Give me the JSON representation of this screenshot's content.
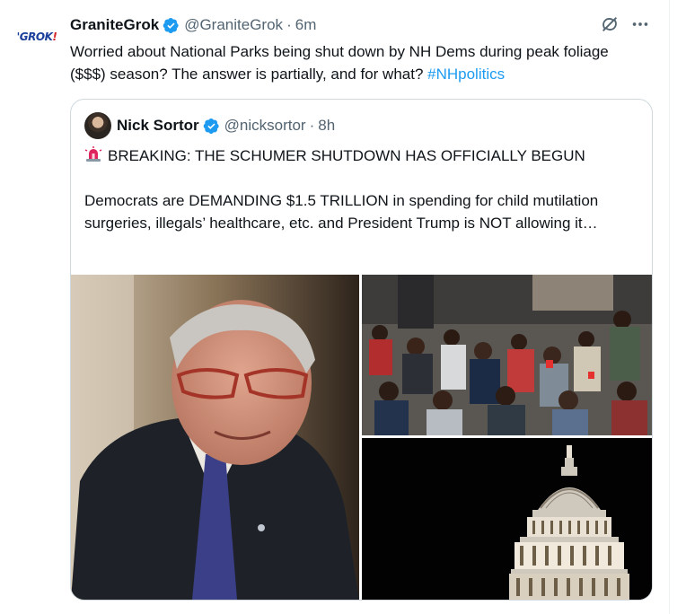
{
  "tweet": {
    "display_name": "GraniteGrok",
    "handle": "@GraniteGrok",
    "separator": "·",
    "time": "6m",
    "avatar_logo": {
      "a": "'GROK",
      "b": "!"
    },
    "text_before": "Worried about National Parks being shut down by NH Dems during peak foliage ($$$) season? The answer is partially, and for what? ",
    "hashtag": "#NHpolitics",
    "verified_icon": "verified-badge-icon",
    "grok_icon": "grok-icon",
    "more_icon": "more-options-icon"
  },
  "quote": {
    "display_name": "Nick Sortor",
    "handle": "@nicksortor",
    "separator": "·",
    "time": "8h",
    "alarm_icon": "rotating-light-icon",
    "line1": "BREAKING: THE SCHUMER SHUTDOWN HAS OFFICIALLY BEGUN",
    "line2": "Democrats are DEMANDING $1.5 TRILLION in spending for child mutilation surgeries, illegals’ healthcare, etc. and President Trump is NOT allowing it…"
  },
  "colors": {
    "text": "#0f1419",
    "muted": "#536471",
    "link": "#1d9bf0",
    "verified": "#1d9bf0",
    "border": "#cfd9de"
  }
}
